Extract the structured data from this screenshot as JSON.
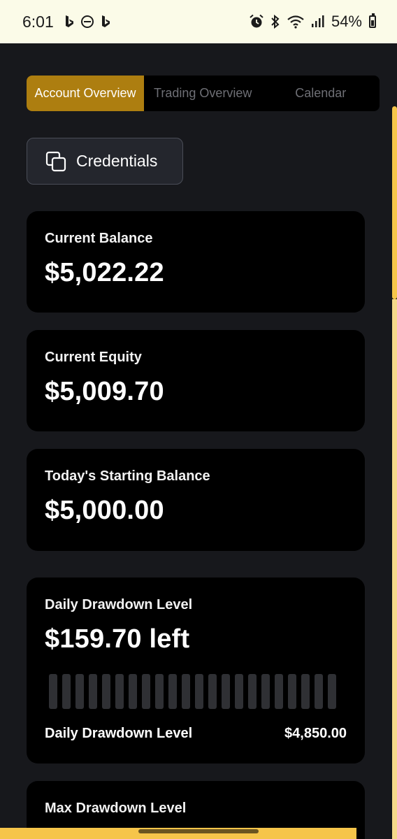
{
  "status_bar": {
    "time": "6:01",
    "battery": "54%"
  },
  "tabs": [
    {
      "label": "Account Overview",
      "active": true
    },
    {
      "label": "Trading Overview",
      "active": false
    },
    {
      "label": "Calendar",
      "active": false
    }
  ],
  "credentials_label": "Credentials",
  "cards": {
    "current_balance": {
      "label": "Current Balance",
      "value": "$5,022.22"
    },
    "current_equity": {
      "label": "Current Equity",
      "value": "$5,009.70"
    },
    "starting_balance": {
      "label": "Today's Starting Balance",
      "value": "$5,000.00"
    },
    "daily_drawdown": {
      "label": "Daily Drawdown Level",
      "value": "$159.70 left",
      "footer_label": "Daily Drawdown Level",
      "footer_value": "$4,850.00",
      "progress_filled": 0
    },
    "max_drawdown": {
      "label": "Max Drawdown Level"
    }
  },
  "colors": {
    "accent": "#ad7e10",
    "background": "#17181c",
    "card": "#000000",
    "scrollbar": "#f6c54a"
  }
}
